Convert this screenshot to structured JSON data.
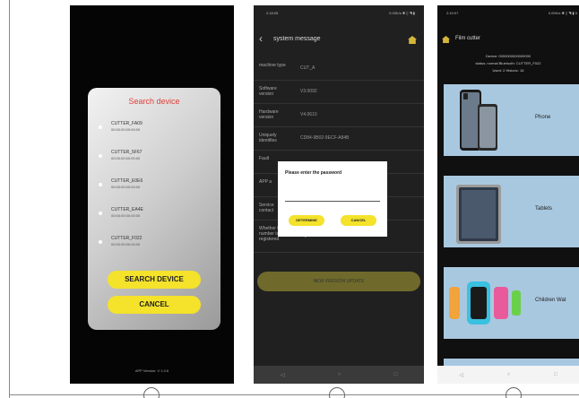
{
  "phone1": {
    "dialog_title": "Search device",
    "devices": [
      {
        "name": "CUTTER_FA09",
        "mac": "00:00:00:00:00:00"
      },
      {
        "name": "CUTTER_5F67",
        "mac": "00:00:00:00:00:00"
      },
      {
        "name": "CUTTER_E0E6",
        "mac": "00:00:00:00:00:00"
      },
      {
        "name": "CUTTER_EA4E",
        "mac": "00:00:00:00:00:00"
      },
      {
        "name": "CUTTER_F022",
        "mac": "00:00:00:00:00:00"
      }
    ],
    "search_button": "SEARCH DEVICE",
    "cancel_button": "CANCEL",
    "version": "APP Version: V 1.0.6"
  },
  "phone2": {
    "status_time": "2:18:05",
    "status_icons": "0.00K/s ✱ ▯ ◥ ▮",
    "back": "‹",
    "title": "system message",
    "rows": [
      {
        "label": "machine type",
        "value": "CUT_A"
      },
      {
        "label": "Software version",
        "value": "V3.0092"
      },
      {
        "label": "Hardware version",
        "value": "V4.0610"
      },
      {
        "label": "Uniquely identifies",
        "value": "CD84-9B02-9ECF-A84B"
      },
      {
        "label": "Fault",
        "value": ""
      },
      {
        "label": "APP a",
        "value": ""
      },
      {
        "label": "Service contact",
        "value": ""
      },
      {
        "label": "Whether the ID number is registered",
        "value": "registered"
      }
    ],
    "password_dialog": {
      "title": "Please enter the password",
      "ok": "DETERMINE",
      "cancel": "CANCEL"
    },
    "update_button": "NEW VERSION UPDATE",
    "nav": [
      "◁",
      "○",
      "□"
    ]
  },
  "phone3": {
    "status_time": "2:19:07",
    "status_icons": "0.05K/s ✱ ▯ ◥ ▮ 5",
    "title": "Film cutter",
    "device_line": "Device: 0000000000000000",
    "status_line": "status: normal   Bluetooth: CUTTER_F022",
    "used_line": "Used: 2   Historic: 16",
    "cards": [
      {
        "label": "Phone"
      },
      {
        "label": "Tablets"
      },
      {
        "label": "Children Wat"
      }
    ],
    "nav": [
      "◁",
      "○",
      "□"
    ]
  }
}
